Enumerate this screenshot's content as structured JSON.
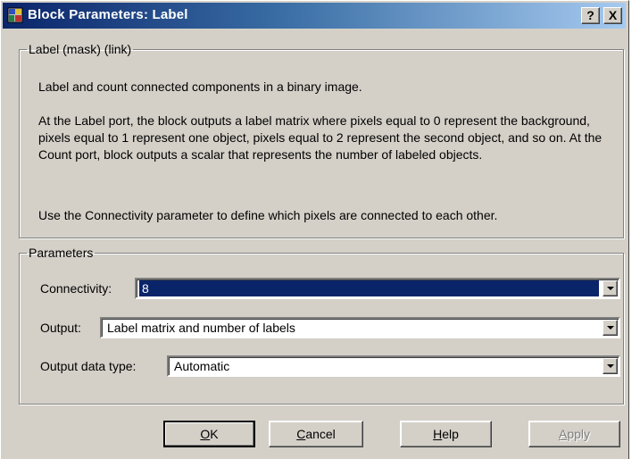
{
  "window": {
    "title": "Block Parameters: Label",
    "help_button": "?",
    "close_button": "X"
  },
  "mask_group": {
    "legend": "Label (mask) (link)",
    "description": [
      "Label and count connected components in a binary image.",
      "At the Label port, the block outputs a label matrix where pixels equal to 0 represent the background, pixels equal to 1 represent one object, pixels equal to 2 represent the second object, and so on.  At the Count port, block outputs a scalar that represents the number of labeled objects.",
      "Use the Connectivity parameter to define which pixels are connected to each other."
    ]
  },
  "parameters": {
    "legend": "Parameters",
    "connectivity": {
      "label": "Connectivity:",
      "value": "8"
    },
    "output": {
      "label": "Output:",
      "value": "Label matrix and number of labels"
    },
    "output_data_type": {
      "label": "Output data type:",
      "value": "Automatic"
    }
  },
  "buttons": {
    "ok": {
      "mnemonic": "O",
      "rest": "K"
    },
    "cancel": {
      "mnemonic": "C",
      "rest": "ancel"
    },
    "help": {
      "mnemonic": "H",
      "rest": "elp"
    },
    "apply": {
      "mnemonic": "A",
      "rest": "pply"
    }
  },
  "colors": {
    "face": "#d4d0c8",
    "title_start": "#0a246a",
    "title_end": "#a6caf0",
    "selection": "#0a246a"
  }
}
